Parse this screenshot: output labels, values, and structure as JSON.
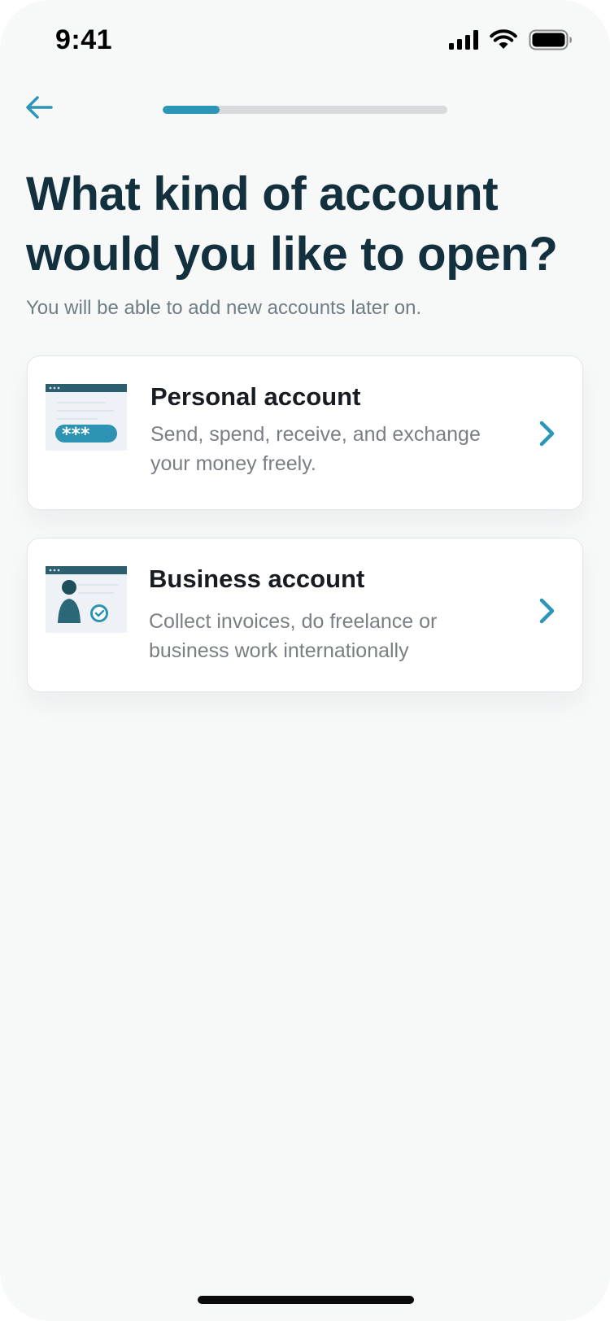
{
  "status_bar": {
    "time": "9:41",
    "icons": [
      "cellular-signal-icon",
      "wifi-icon",
      "battery-icon"
    ]
  },
  "nav": {
    "back_icon": "arrow-left-icon",
    "progress": 0.2
  },
  "header": {
    "title": "What kind of account would you like to open?",
    "subtitle": "You will be able to add new accounts later on."
  },
  "options": [
    {
      "title": "Personal account",
      "description": "Send, spend, receive, and exchange your money freely.",
      "icon": "password-window-icon"
    },
    {
      "title": "Business account",
      "description": "Collect invoices, do freelance or business work internationally",
      "icon": "verified-user-window-icon"
    }
  ],
  "colors": {
    "accent": "#2c96b8",
    "title": "#13303e",
    "background": "#f7f8f8"
  }
}
